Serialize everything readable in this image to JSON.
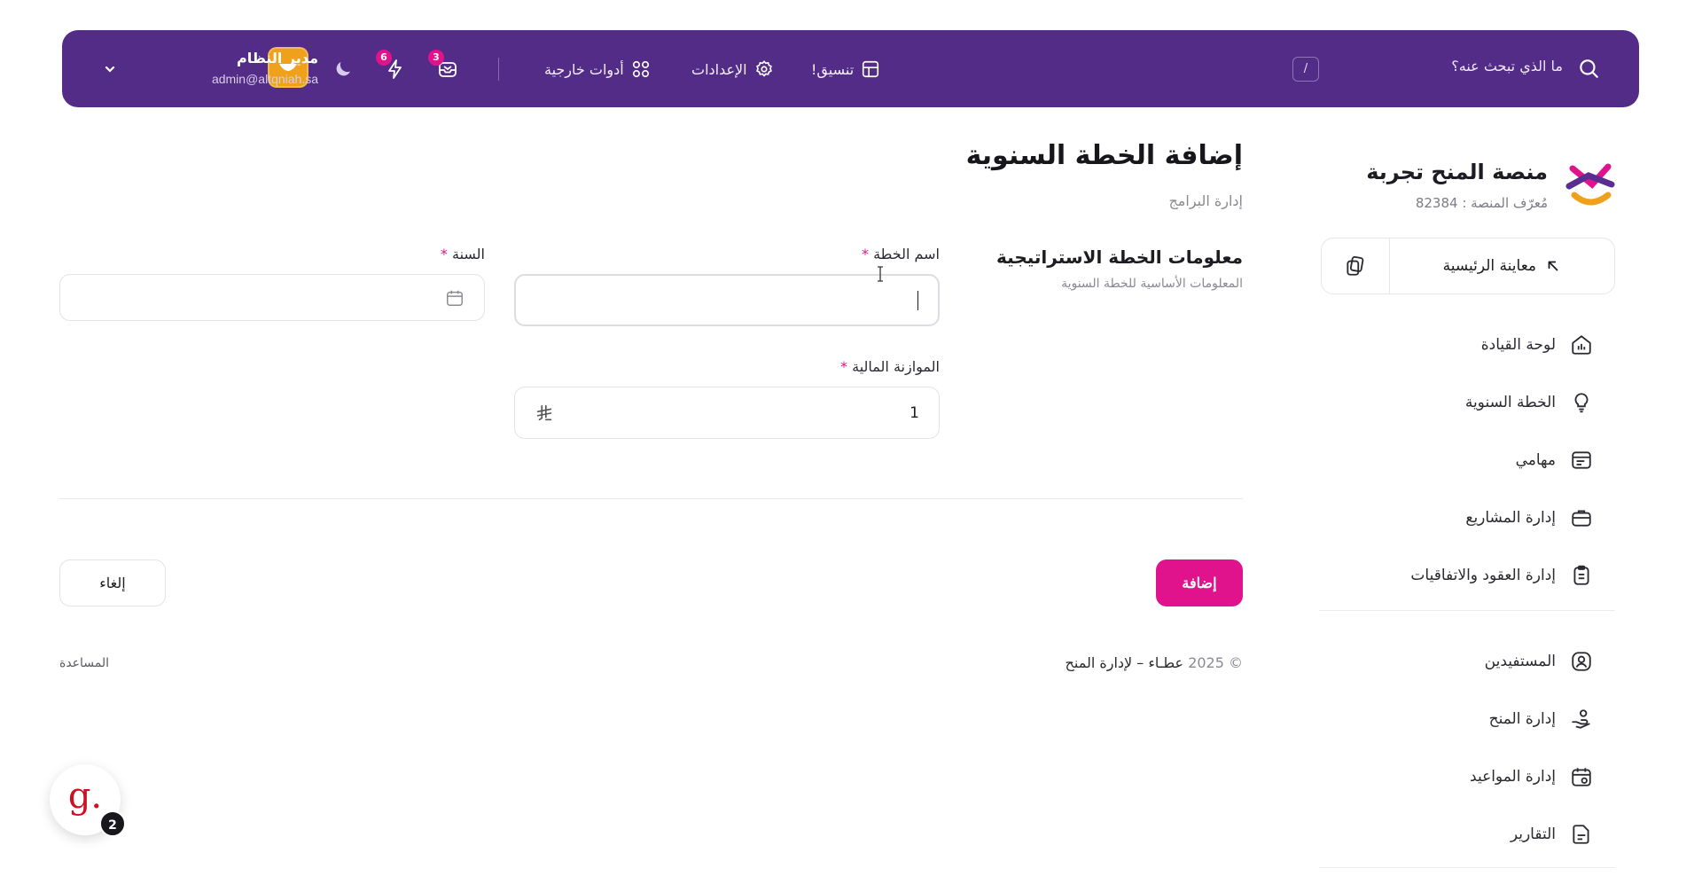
{
  "topbar": {
    "search_placeholder": "ما الذي تبحث عنه؟",
    "shortcut_key": "/",
    "nav": {
      "format_label": "تنسيق!",
      "settings_label": "الإعدادات",
      "tools_label": "أدوات خارجية"
    },
    "inbox_badge": "3",
    "bolt_badge": "6",
    "user": {
      "name": "مدير النظام",
      "email": "admin@altqniah.sa"
    }
  },
  "sidebar": {
    "platform_name": "منصة المنح تجربة",
    "platform_id": "مُعرّف المنصة : 82384",
    "preview_label": "معاينة الرئيسية",
    "items": [
      {
        "label": "لوحة القيادة",
        "icon": "dashboard-icon"
      },
      {
        "label": "الخطة السنوية",
        "icon": "lightbulb-icon"
      },
      {
        "label": "مهامي",
        "icon": "tasks-icon"
      },
      {
        "label": "إدارة المشاريع",
        "icon": "briefcase-icon"
      },
      {
        "label": "إدارة العقود والاتفاقيات",
        "icon": "clipboard-icon"
      },
      {
        "label": "المستفيدين",
        "icon": "user-badge-icon"
      },
      {
        "label": "إدارة المنح",
        "icon": "grant-hand-icon"
      },
      {
        "label": "إدارة المواعيد",
        "icon": "calendar-icon"
      },
      {
        "label": "التقارير",
        "icon": "report-icon"
      }
    ]
  },
  "main": {
    "title": "إضافة الخطة السنوية",
    "breadcrumb": "إدارة البرامج",
    "section_title": "معلومات الخطة الاستراتيجية",
    "section_subtitle": "المعلومات الأساسية للخطة السنوية",
    "fields": {
      "plan_name_label": "اسم الخطة",
      "plan_name_value": "",
      "year_label": "السنة",
      "year_value": "",
      "budget_label": "الموازنة المالية",
      "budget_value": "1",
      "required_mark": "*"
    },
    "add_button": "إضافة",
    "cancel_button": "إلغاء",
    "copyright_year": "© 2025",
    "copyright_text": "عطـاء – لإدارة المنح",
    "help_link": "المساعدة"
  },
  "widget": {
    "letter": "g.",
    "badge": "2"
  },
  "colors": {
    "topbar_bg": "#532c87",
    "accent": "#e0138d",
    "avatar_bg": "#f0a11c"
  }
}
